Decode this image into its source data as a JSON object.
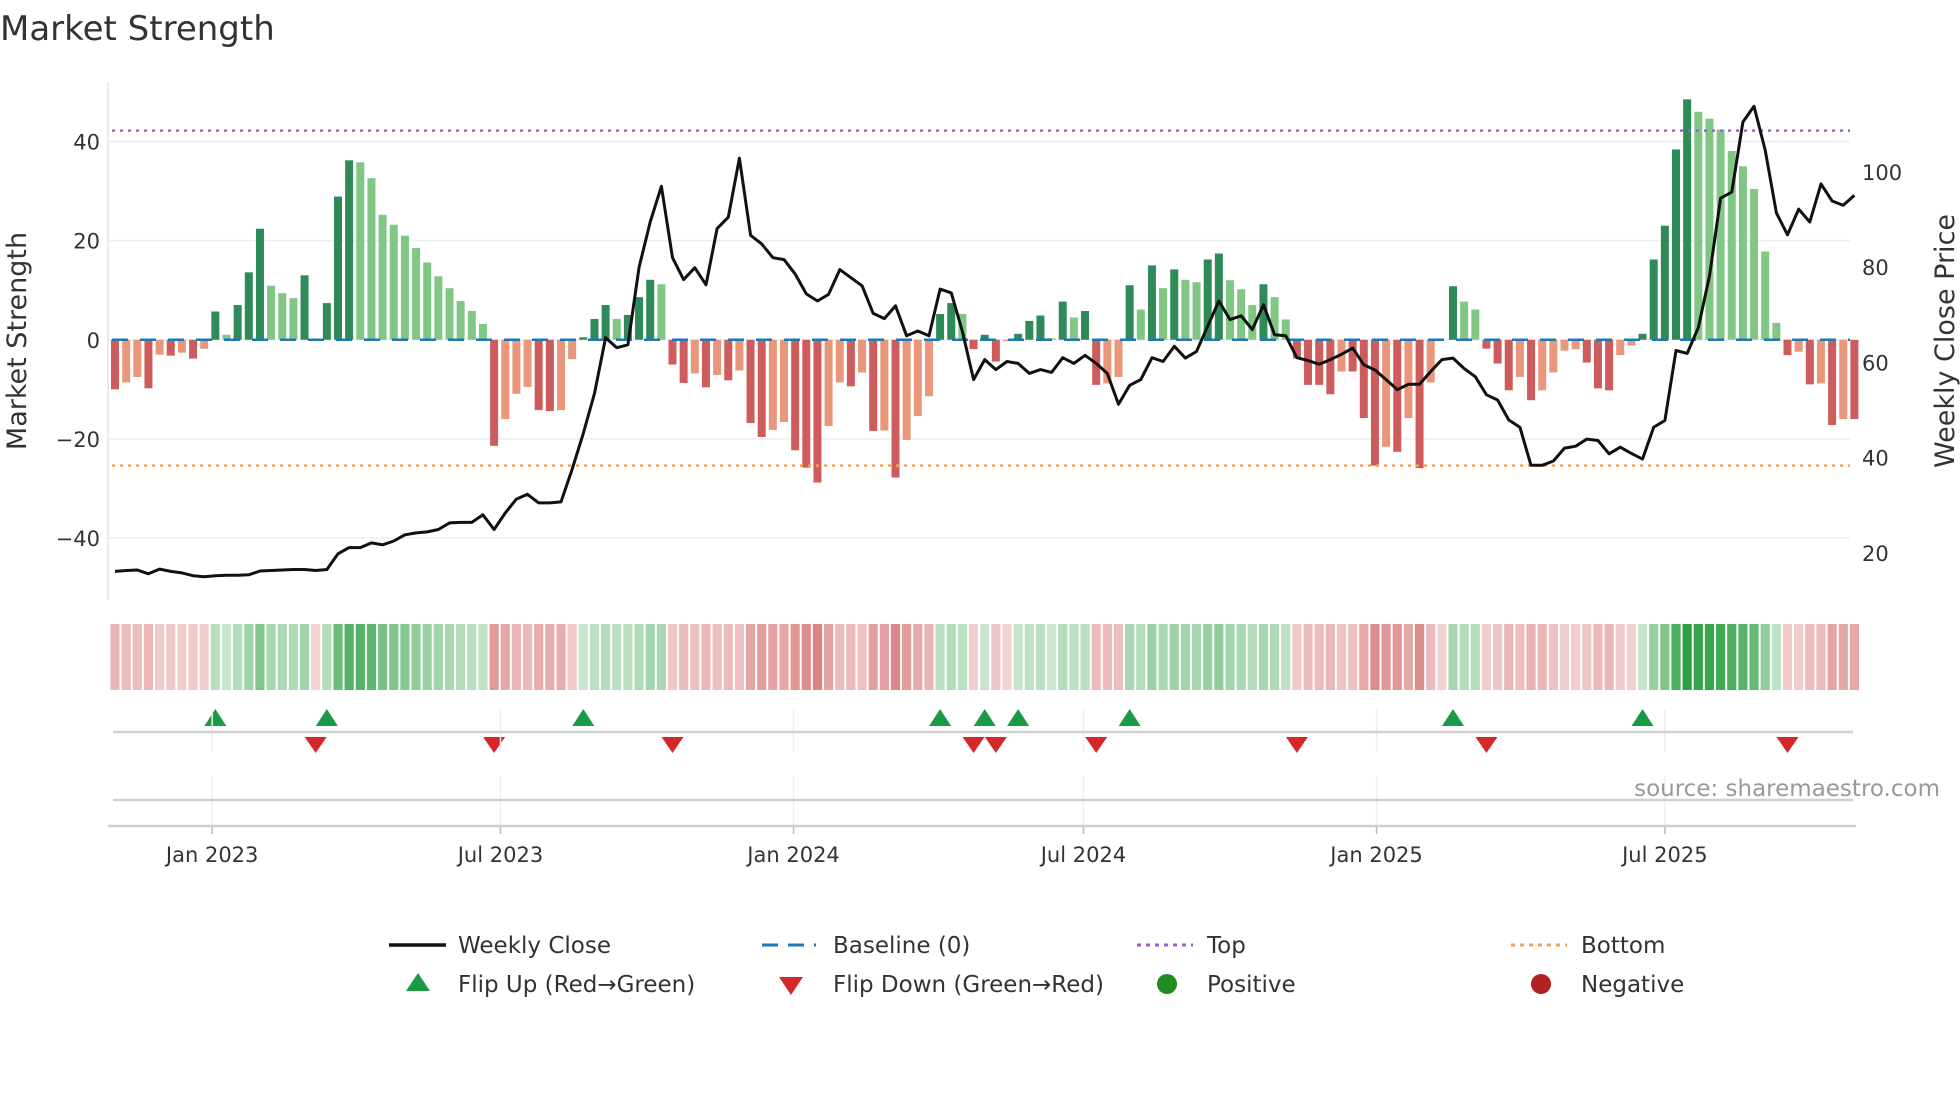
{
  "chart_data": {
    "type": "bar",
    "title": "Market Strength",
    "ylabel": "Market Strength",
    "y2label": "Weekly Close Price",
    "source": "source: sharemaestro.com",
    "start_date": "2022-11-01",
    "frequency": "weekly",
    "ylim": [
      -52.5,
      52
    ],
    "y2lim": [
      10.1,
      118.9
    ],
    "yticks": [
      -40,
      -20,
      0,
      20,
      40
    ],
    "y2ticks": [
      20,
      40,
      60,
      80,
      100
    ],
    "xticks": [
      {
        "date": "2023-01-01",
        "label": "Jan 2023"
      },
      {
        "date": "2023-07-01",
        "label": "Jul 2023"
      },
      {
        "date": "2024-01-01",
        "label": "Jan 2024"
      },
      {
        "date": "2024-07-01",
        "label": "Jul 2024"
      },
      {
        "date": "2025-01-01",
        "label": "Jan 2025"
      },
      {
        "date": "2025-07-01",
        "label": "Jul 2025"
      }
    ],
    "top_level": 42.2,
    "bottom_level": -25.4,
    "baseline": 0,
    "strength": [
      -10,
      -8.6,
      -7.5,
      -9.8,
      -3,
      -3.2,
      -2.6,
      -3.8,
      -1.8,
      5.7,
      1,
      7,
      13.6,
      22.4,
      10.9,
      9.4,
      8.4,
      13,
      -0.2,
      7.4,
      28.9,
      36.2,
      35.8,
      32.6,
      25.2,
      23.2,
      21,
      18.5,
      15.6,
      12.8,
      10.4,
      7.8,
      5.8,
      3.2,
      -21.4,
      -16,
      -10.9,
      -9.5,
      -14.2,
      -14.4,
      -14.2,
      -3.9,
      0.5,
      4.2,
      7,
      4.2,
      5,
      8.6,
      12.1,
      11.2,
      -5,
      -8.7,
      -6.8,
      -9.6,
      -7.1,
      -8.2,
      -6.2,
      -16.8,
      -19.6,
      -18.2,
      -16.6,
      -22.3,
      -25.8,
      -28.8,
      -17.4,
      -8.6,
      -9.4,
      -6.6,
      -18.4,
      -18.3,
      -27.8,
      -20.2,
      -15.4,
      -11.4,
      5.2,
      7.4,
      5.2,
      -1.9,
      1,
      -4.4,
      -0.3,
      1.2,
      3.8,
      4.9,
      0.3,
      7.7,
      4.5,
      5.8,
      -9.1,
      -8.8,
      -7.5,
      11,
      6.1,
      15,
      10.4,
      14.2,
      12.1,
      11.6,
      16.2,
      17.4,
      12,
      10.2,
      7,
      11.2,
      8.6,
      4.1,
      -3.8,
      -9.1,
      -9.1,
      -11,
      -6.4,
      -6.4,
      -15.8,
      -25.4,
      -21.6,
      -22.6,
      -15.8,
      -25.9,
      -8.6,
      0,
      10.8,
      7.7,
      6.1,
      -1.8,
      -4.8,
      -10.2,
      -7.5,
      -12.2,
      -10.2,
      -6.6,
      -2.2,
      -1.9,
      -4.6,
      -9.8,
      -10.2,
      -3.1,
      -1.2,
      1.2,
      16.2,
      23,
      38.4,
      48.5,
      46,
      44.6,
      42.4,
      38.1,
      35,
      30.4,
      17.8,
      3.4,
      -3.1,
      -2.4,
      -9,
      -8.8,
      -17.2,
      -16,
      -16
    ],
    "weekly_close": [
      16.1,
      16.3,
      16.4,
      15.6,
      16.6,
      16.1,
      15.8,
      15.2,
      15,
      15.2,
      15.3,
      15.3,
      15.4,
      16.2,
      16.3,
      16.4,
      16.5,
      16.5,
      16.3,
      16.5,
      19.8,
      21.1,
      21.1,
      22.1,
      21.7,
      22.5,
      23.8,
      24.2,
      24.4,
      24.9,
      26.3,
      26.4,
      26.4,
      28,
      24.9,
      28.4,
      31.3,
      32.3,
      30.5,
      30.5,
      30.7,
      37.6,
      45.1,
      53.5,
      65.2,
      63.1,
      63.7,
      80,
      89.5,
      97,
      82,
      77.4,
      79.9,
      76.3,
      88.1,
      90.5,
      102.9,
      86.7,
      84.9,
      82,
      81.6,
      78.6,
      74.4,
      72.9,
      74.3,
      79.5,
      77.8,
      76.1,
      70.3,
      69.2,
      71.9,
      65.6,
      66.6,
      65.6,
      75.4,
      74.6,
      66.5,
      56.4,
      60.6,
      58.5,
      60.2,
      59.8,
      57.7,
      58.5,
      57.9,
      61,
      59.8,
      61.5,
      59.8,
      57.7,
      51.2,
      55.2,
      56.4,
      61,
      60.2,
      63.4,
      60.9,
      62.3,
      67.6,
      72.9,
      69,
      69.8,
      66.9,
      72.1,
      65.8,
      65.6,
      61,
      60.4,
      59.6,
      60.6,
      61.7,
      63,
      59.5,
      58.4,
      56.4,
      54.3,
      55.4,
      55.4,
      58.1,
      60.6,
      60.9,
      58.7,
      57,
      53.2,
      52.1,
      47.9,
      46.4,
      38.4,
      38.4,
      39.3,
      42,
      42.4,
      43.9,
      43.6,
      40.8,
      42.2,
      40.9,
      39.7,
      46.4,
      47.8,
      62.5,
      61.9,
      67.3,
      78.2,
      94.5,
      95.8,
      110.5,
      113.8,
      104.6,
      91.4,
      86.8,
      92.2,
      89.5,
      97.5,
      93.9,
      93,
      95.1
    ],
    "legend": [
      {
        "label": "Weekly Close",
        "symbol": "line"
      },
      {
        "label": "Baseline (0)",
        "symbol": "dashed"
      },
      {
        "label": "Top",
        "symbol": "dotted"
      },
      {
        "label": "Bottom",
        "symbol": "dotted"
      },
      {
        "label": "Flip Up (Red→Green)",
        "symbol": "triangle-up"
      },
      {
        "label": "Flip Down (Green→Red)",
        "symbol": "triangle-down"
      },
      {
        "label": "Positive",
        "symbol": "circle"
      },
      {
        "label": "Negative",
        "symbol": "circle"
      }
    ],
    "legend_position": "bottom-center",
    "colors": {
      "pos_dark": "#2e8b57",
      "pos_light": "#81c784",
      "neg_dark": "#cd5c5c",
      "neg_light": "#e9967a",
      "line": "#111111",
      "baseline": "#1f77b4",
      "top": "#9a5fd6",
      "bottom": "#f5a05a",
      "flip_up": "#1a9a45",
      "flip_down": "#d62728",
      "positive": "#228b22",
      "negative": "#b22222",
      "heat_pos": "46,160,67",
      "heat_neg": "205,80,80"
    }
  }
}
